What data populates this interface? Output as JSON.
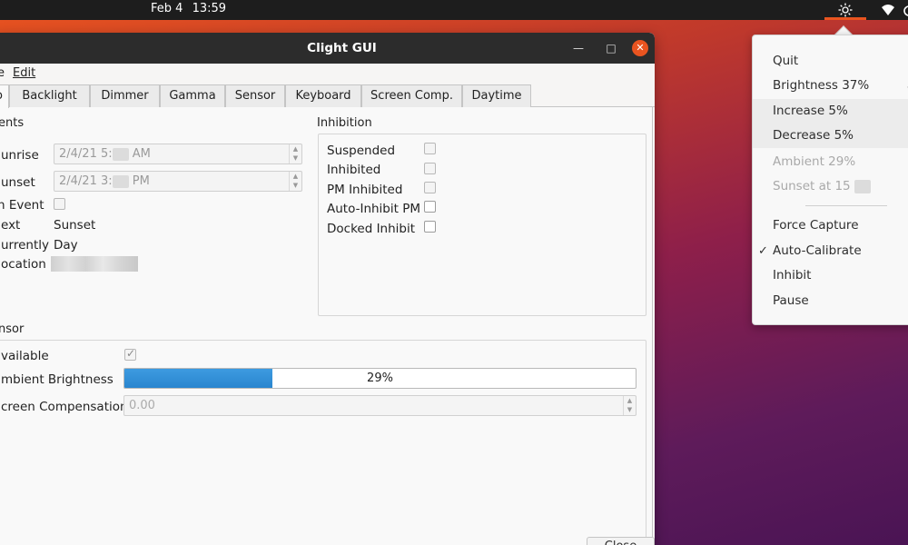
{
  "topbar": {
    "date": "Feb 4",
    "time": "13:59"
  },
  "window": {
    "title": "Clight GUI",
    "menu": [
      "e",
      "Edit"
    ],
    "tabs": [
      "o",
      "Backlight",
      "Dimmer",
      "Gamma",
      "Sensor",
      "Keyboard",
      "Screen Comp.",
      "Daytime"
    ],
    "close_button": "Close"
  },
  "events": {
    "group_label": "ents",
    "sunrise_label": "unrise",
    "sunrise_value_prefix": "2/4/21 5:",
    "sunrise_value_suffix": "AM",
    "sunset_label": "unset",
    "sunset_value_prefix": "2/4/21 3:",
    "sunset_value_suffix": "PM",
    "in_event_label": "n Event",
    "next_label": "ext",
    "next_value": "Sunset",
    "currently_label": "urrently",
    "currently_value": "Day",
    "location_label": "ocation"
  },
  "inhibition": {
    "group_label": "Inhibition",
    "items": [
      "Suspended",
      "Inhibited",
      "PM Inhibited",
      "Auto-Inhibit PM",
      "Docked Inhibit"
    ]
  },
  "sensor": {
    "group_label": "nsor",
    "available_label": "vailable",
    "available_checked": true,
    "ambient_label": "mbient Brightness",
    "ambient_value": 29,
    "ambient_text": "29%",
    "screen_comp_label": "creen Compensation",
    "screen_comp_value": "0.00"
  },
  "popup": {
    "items": [
      {
        "label": "Quit"
      },
      {
        "label": "Brightness 37%"
      },
      {
        "label": "Increase 5%"
      },
      {
        "label": "Decrease 5%"
      },
      {
        "label": "Ambient 29%"
      },
      {
        "label": "Sunset at 15"
      },
      {
        "label": "Force Capture"
      },
      {
        "label": "Auto-Calibrate",
        "checked": "✓"
      },
      {
        "label": "Inhibit"
      },
      {
        "label": "Pause"
      }
    ]
  },
  "colors": {
    "accent": "#e95420",
    "progress": "#2a86cf"
  }
}
